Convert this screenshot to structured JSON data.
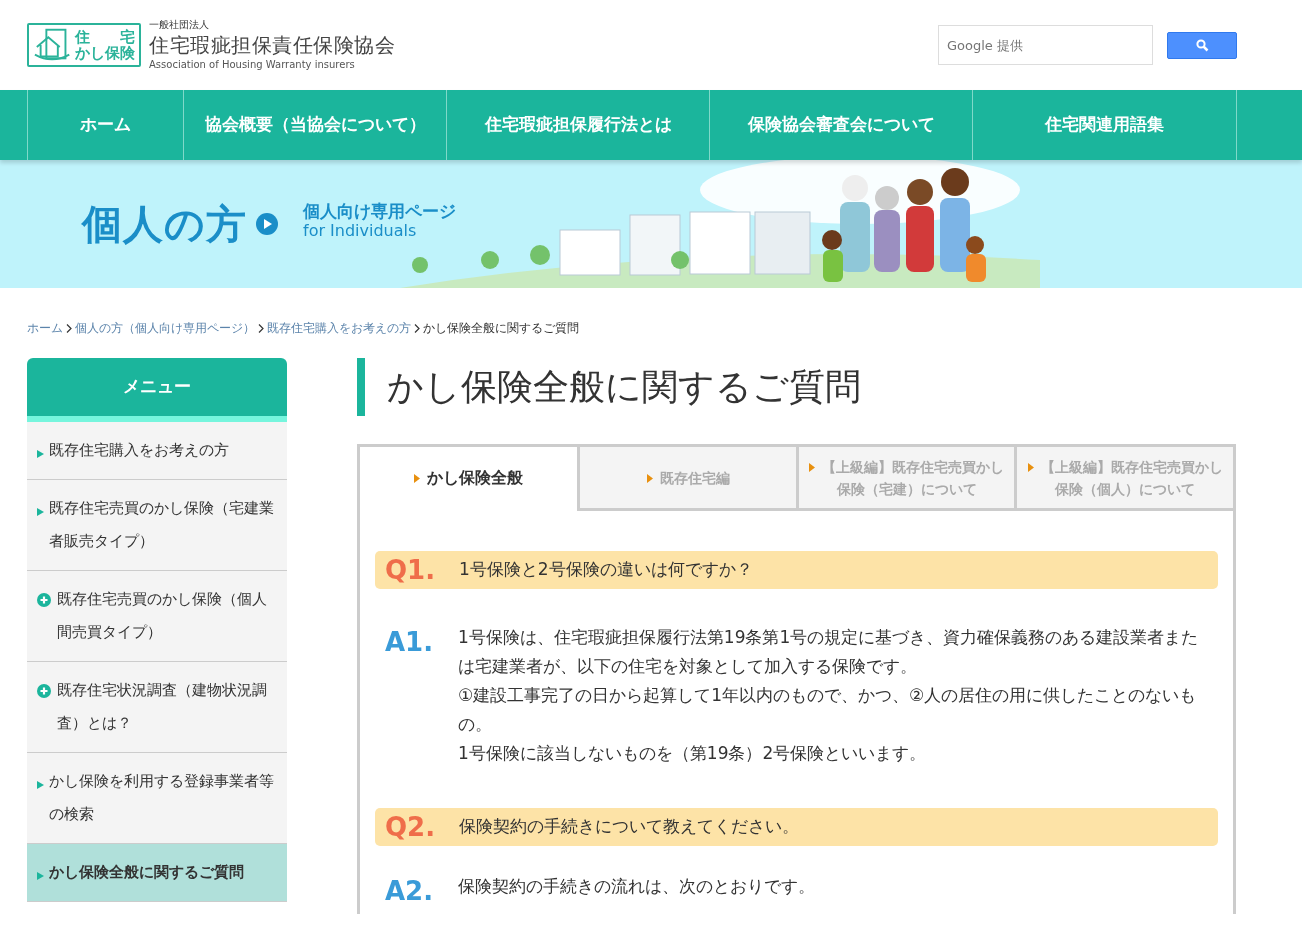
{
  "header": {
    "logo_mark_top": [
      "住",
      "宅"
    ],
    "logo_mark_bottom": "かし保険",
    "org_type": "一般社団法人",
    "org_name": "住宅瑕疵担保責任保険協会",
    "org_name_en": "Association of Housing Warranty insurers",
    "search": {
      "placeholder": "Google 提供"
    }
  },
  "nav": [
    {
      "label": "ホーム",
      "selected": false
    },
    {
      "label": "協会概要（当協会について）",
      "selected": false
    },
    {
      "label": "住宅瑕疵担保履行法とは",
      "selected": false
    },
    {
      "label": "保険協会審査会について",
      "selected": false
    },
    {
      "label": "住宅関連用語集",
      "selected": false
    }
  ],
  "banner": {
    "title": "個人の方",
    "subtitle": "個人向け専用ページ",
    "subtitle_en": "for Individuals"
  },
  "breadcrumb": [
    {
      "label": "ホーム",
      "link": true
    },
    {
      "label": "個人の方（個人向け専用ページ）",
      "link": true
    },
    {
      "label": "既存住宅購入をお考えの方",
      "link": true
    },
    {
      "label": "かし保険全般に関するご質問",
      "link": false
    }
  ],
  "sidebar": {
    "title": "メニュー",
    "items": [
      {
        "label": "既存住宅購入をお考えの方",
        "kind": "arrow",
        "selected": false
      },
      {
        "label": "既存住宅売買のかし保険（宅建業者販売タイプ）",
        "kind": "arrow",
        "selected": false
      },
      {
        "label": "既存住宅売買のかし保険（個人間売買タイプ）",
        "kind": "plus",
        "selected": false
      },
      {
        "label": "既存住宅状況調査（建物状況調査）とは？",
        "kind": "plus",
        "selected": false
      },
      {
        "label": "かし保険を利用する登録事業者等の検索",
        "kind": "arrow",
        "selected": false
      },
      {
        "label": "かし保険全般に関するご質問",
        "kind": "arrow",
        "selected": true
      }
    ]
  },
  "page_title": "かし保険全般に関するご質問",
  "tabs": [
    {
      "label": "かし保険全般",
      "selected": true
    },
    {
      "label": "既存住宅編",
      "selected": false
    },
    {
      "label": "【上級編】既存住宅売買かし保険（宅建）について",
      "selected": false
    },
    {
      "label": "【上級編】既存住宅売買かし保険（個人）について",
      "selected": false
    }
  ],
  "faq": [
    {
      "q_no": "Q1.",
      "question": "1号保険と2号保険の違いは何ですか？",
      "a_no": "A1.",
      "answer": [
        "1号保険は、住宅瑕疵担保履行法第19条第1号の規定に基づき、資力確保義務のある建設業者または宅建業者が、以下の住宅を対象として加入する保険です。",
        "①建設工事完了の日から起算して1年以内のもので、かつ、②人の居住の用に供したことのないもの。",
        "1号保険に該当しないものを（第19条）2号保険といいます。"
      ]
    },
    {
      "q_no": "Q2.",
      "question": "保険契約の手続きについて教えてください。",
      "a_no": "A2.",
      "answer": [
        "保険契約の手続きの流れは、次のとおりです。"
      ]
    }
  ]
}
